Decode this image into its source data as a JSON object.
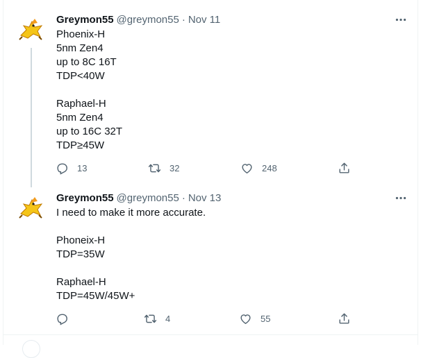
{
  "tweets": [
    {
      "author_name": "Greymon55",
      "handle": "@greymon55",
      "separator": "·",
      "date": "Nov 11",
      "text": "Phoenix-H\n5nm Zen4\nup to 8C 16T\nTDP<40W\n\nRaphael-H\n5nm Zen4\nup to 16C 32T\nTDP≥45W",
      "replies": "13",
      "retweets": "32",
      "likes": "248"
    },
    {
      "author_name": "Greymon55",
      "handle": "@greymon55",
      "separator": "·",
      "date": "Nov 13",
      "text": "I need to make it more accurate.\n\nPhoneix-H\nTDP=35W\n\nRaphael-H\nTDP=45W/45W+",
      "replies": "",
      "retweets": "4",
      "likes": "55"
    }
  ],
  "icons": {
    "more": "more-dots-icon",
    "reply": "reply-icon",
    "retweet": "retweet-icon",
    "like": "heart-icon",
    "share": "share-icon"
  },
  "colors": {
    "text": "#0f1419",
    "secondary": "#536471",
    "thread_line": "#cfd9de",
    "divider": "#eff3f4"
  }
}
